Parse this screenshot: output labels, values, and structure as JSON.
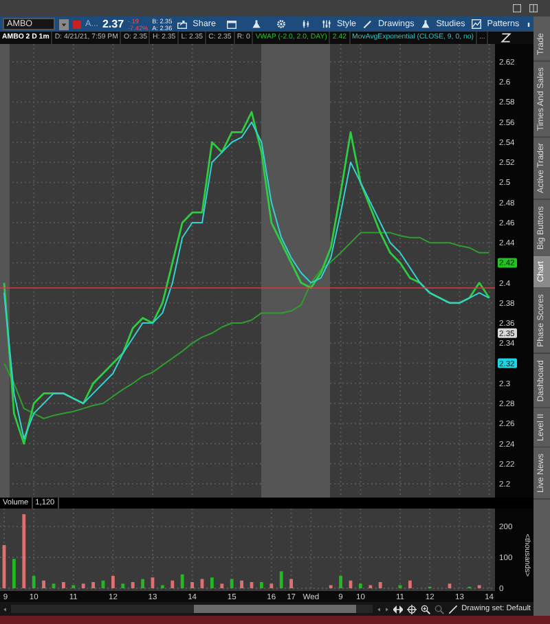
{
  "toolbar": {
    "symbol": "AMBO",
    "exchange": "A...",
    "last": "2.37",
    "change": "-.19",
    "change_pct": "-7.42%",
    "bid": "B: 2.35",
    "ask": "A: 2.36",
    "buttons": [
      {
        "label": "Share"
      },
      {
        "label": "Style"
      },
      {
        "label": "Drawings"
      },
      {
        "label": "Studies"
      },
      {
        "label": "Patterns"
      }
    ]
  },
  "info_bar": [
    {
      "text": "AMBO 2 D 1m",
      "kind": "symbol"
    },
    {
      "text": "D: 4/21/21, 7:59 PM",
      "kind": "field"
    },
    {
      "text": "O: 2.35",
      "kind": "field"
    },
    {
      "text": "H: 2.35",
      "kind": "field"
    },
    {
      "text": "L: 2.35",
      "kind": "field"
    },
    {
      "text": "C: 2.35",
      "kind": "field"
    },
    {
      "text": "R: 0",
      "kind": "field"
    },
    {
      "text": "VWAP (-2.0, 2.0, DAY)",
      "kind": "vwap"
    },
    {
      "text": "2.42",
      "kind": "vwap"
    },
    {
      "text": "MovAvgExponential (CLOSE, 9, 0, no)",
      "kind": "ema"
    },
    {
      "text": "...",
      "kind": "field"
    }
  ],
  "price_chart": {
    "chart_data": {
      "type": "line",
      "grid": true,
      "ylim": [
        2.2,
        2.62
      ],
      "categories": [
        null,
        null,
        null,
        null,
        null,
        null,
        null,
        null,
        null,
        null,
        null,
        null,
        null,
        null,
        null,
        null,
        null,
        null,
        null,
        null,
        null,
        null,
        null,
        null,
        null,
        null,
        null,
        null,
        null,
        null,
        null,
        null,
        null,
        null,
        null,
        null,
        null,
        null,
        null,
        null,
        null,
        null,
        null,
        null,
        null,
        null,
        null,
        null,
        null,
        null
      ],
      "yticks": [
        {
          "value": 2.2,
          "label": "2.2"
        },
        {
          "value": 2.22,
          "label": "2.22"
        },
        {
          "value": 2.24,
          "label": "2.24"
        },
        {
          "value": 2.26,
          "label": "2.26"
        },
        {
          "value": 2.28,
          "label": "2.28"
        },
        {
          "value": 2.3,
          "label": "2.3"
        },
        2.32,
        {
          "value": 2.34,
          "label": "2.34"
        },
        {
          "value": 2.36,
          "label": "2.36"
        },
        {
          "value": 2.38,
          "label": "2.38"
        },
        {
          "value": 2.4,
          "label": "2.4"
        },
        2.42,
        {
          "value": 2.44,
          "label": "2.44"
        },
        {
          "value": 2.46,
          "label": "2.46"
        },
        {
          "value": 2.48,
          "label": "2.48"
        },
        {
          "value": 2.5,
          "label": "2.5"
        },
        {
          "value": 2.52,
          "label": "2.52"
        },
        {
          "value": 2.54,
          "label": "2.54"
        },
        {
          "value": 2.56,
          "label": "2.56"
        },
        {
          "value": 2.58,
          "label": "2.58"
        },
        {
          "value": 2.6,
          "label": "2.6"
        },
        {
          "value": 2.62,
          "label": "2.62"
        }
      ],
      "series": [
        {
          "color": "#2f9e2f",
          "values": [
            2.32,
            2.3,
            2.275,
            2.27,
            2.265,
            2.268,
            2.27,
            2.272,
            2.275,
            2.278,
            2.28,
            2.287,
            2.294,
            2.3,
            2.307,
            2.311,
            2.318,
            2.325,
            2.332,
            2.34,
            2.346,
            2.35,
            2.356,
            2.36,
            2.36,
            2.363,
            2.37,
            2.37,
            2.37,
            2.372,
            2.378,
            2.4,
            2.413,
            2.421,
            2.43,
            2.44,
            2.45,
            2.45,
            2.45,
            2.45,
            2.447,
            2.445,
            2.445,
            2.44,
            2.44,
            2.44,
            2.437,
            2.435,
            2.43,
            2.43
          ]
        },
        {
          "color": "#2ecc40",
          "values": [
            2.4,
            2.27,
            2.24,
            2.28,
            2.29,
            2.29,
            2.29,
            2.285,
            2.28,
            2.3,
            2.31,
            2.32,
            2.33,
            2.355,
            2.365,
            2.36,
            2.38,
            2.42,
            2.46,
            2.47,
            2.47,
            2.54,
            2.53,
            2.55,
            2.55,
            2.57,
            2.53,
            2.46,
            2.44,
            2.42,
            2.4,
            2.395,
            2.41,
            2.435,
            2.49,
            2.55,
            2.5,
            2.475,
            2.45,
            2.43,
            2.42,
            2.405,
            2.4,
            2.39,
            2.385,
            2.38,
            2.38,
            2.385,
            2.4,
            2.385
          ]
        },
        {
          "color": "#35d0d0",
          "values": [
            2.39,
            2.29,
            2.245,
            2.27,
            2.28,
            2.29,
            2.29,
            2.285,
            2.28,
            2.29,
            2.3,
            2.31,
            2.33,
            2.345,
            2.36,
            2.36,
            2.37,
            2.4,
            2.445,
            2.46,
            2.46,
            2.52,
            2.53,
            2.54,
            2.545,
            2.56,
            2.54,
            2.48,
            2.445,
            2.425,
            2.41,
            2.4,
            2.405,
            2.425,
            2.47,
            2.52,
            2.5,
            2.48,
            2.46,
            2.44,
            2.43,
            2.415,
            2.4,
            2.39,
            2.385,
            2.38,
            2.38,
            2.385,
            2.39,
            2.385
          ]
        }
      ],
      "ref_lines": [
        {
          "axis": "y",
          "value": 2.395
        }
      ]
    },
    "price_tags": [
      {
        "text": "2.42",
        "color": "#22c322"
      },
      {
        "text": "2.35",
        "color": "#d9d9d9"
      },
      {
        "text": "2.32",
        "color": "#19d6e6"
      }
    ]
  },
  "volume_chart": {
    "reading": "1,120",
    "chart_data": {
      "type": "bar",
      "title": "Volume",
      "ylabel": "<thousands>",
      "ylim": [
        0,
        245
      ],
      "stacked": true,
      "grid": true,
      "categories": [
        "9",
        null,
        null,
        "10",
        null,
        null,
        null,
        "11",
        null,
        null,
        null,
        "12",
        null,
        null,
        null,
        "13",
        null,
        null,
        null,
        "14",
        null,
        null,
        null,
        "15",
        null,
        null,
        null,
        "16",
        null,
        "17",
        null,
        "Wed",
        null,
        null,
        "9",
        null,
        "10",
        null,
        null,
        null,
        "11",
        null,
        null,
        "12",
        null,
        null,
        "13",
        null,
        null,
        "14"
      ],
      "yticks": [
        0,
        100,
        200
      ],
      "series": [
        {
          "color": "#22b822",
          "values": [
            null,
            95,
            null,
            40,
            null,
            15,
            null,
            10,
            null,
            null,
            25,
            null,
            15,
            null,
            30,
            null,
            10,
            null,
            45,
            null,
            null,
            35,
            null,
            30,
            null,
            null,
            20,
            null,
            55,
            null,
            null,
            null,
            null,
            null,
            40,
            null,
            15,
            null,
            null,
            null,
            10,
            null,
            null,
            5,
            null,
            null,
            null,
            5,
            null,
            null
          ]
        },
        {
          "color": "#e07070",
          "values": [
            140,
            null,
            240,
            null,
            25,
            null,
            20,
            null,
            15,
            20,
            null,
            40,
            null,
            20,
            null,
            35,
            null,
            25,
            null,
            20,
            30,
            null,
            15,
            null,
            25,
            20,
            null,
            15,
            null,
            30,
            null,
            null,
            null,
            10,
            null,
            25,
            null,
            10,
            20,
            null,
            null,
            25,
            null,
            null,
            null,
            15,
            null,
            null,
            10,
            null
          ]
        }
      ]
    }
  },
  "status": {
    "drawing_set": "Drawing set: Default"
  },
  "side_tabs": [
    {
      "label": "Trade",
      "selected": false
    },
    {
      "label": "Times And Sales",
      "selected": false
    },
    {
      "label": "Active Trader",
      "selected": false
    },
    {
      "label": "Big Buttons",
      "selected": false
    },
    {
      "label": "Chart",
      "selected": true
    },
    {
      "label": "Phase Scores",
      "selected": false
    },
    {
      "label": "Dashboard",
      "selected": false
    },
    {
      "label": "Level II",
      "selected": false
    },
    {
      "label": "Live News",
      "selected": false
    }
  ]
}
